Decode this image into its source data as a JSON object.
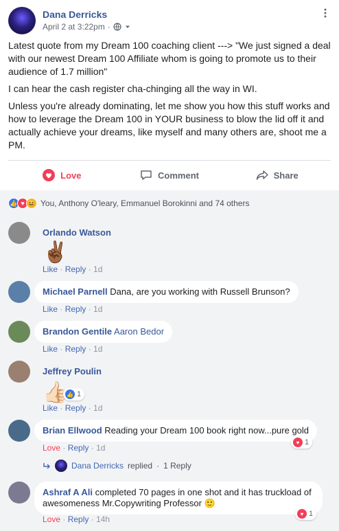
{
  "post": {
    "author": "Dana Derricks",
    "timestamp": "April 2 at 3:22pm",
    "separator": "·",
    "privacy_icon": "globe-icon",
    "paragraphs": [
      "Latest quote from my Dream 100 coaching client ---> \"We just signed a deal with our newest Dream 100 Affiliate whom is going to promote us to their audience of 1.7 million\"",
      "I can hear the cash register cha-chinging all the way in WI.",
      "Unless you're already dominating, let me show you how this stuff works and how to leverage the Dream 100 in YOUR business to blow the lid off it and actually achieve your dreams, like myself and many others are, shoot me a PM."
    ]
  },
  "actions": {
    "love": "Love",
    "comment": "Comment",
    "share": "Share"
  },
  "reactions": {
    "summary": "You, Anthony O'leary, Emmanuel Borokinni and 74 others"
  },
  "comments": [
    {
      "name": "Orlando Watson",
      "text": "",
      "sticker": "✌🏾",
      "like": "Like",
      "reply": "Reply",
      "time": "1d"
    },
    {
      "name": "Michael Parnell",
      "text": "Dana, are you working with Russell Brunson?",
      "like": "Like",
      "reply": "Reply",
      "time": "1d"
    },
    {
      "name": "Brandon Gentile",
      "text": "Aaron Bedor",
      "like": "Like",
      "reply": "Reply",
      "time": "1d"
    },
    {
      "name": "Jeffrey Poulin",
      "text": "",
      "sticker": "👍🏻",
      "reaction_count": "1",
      "like": "Like",
      "reply": "Reply",
      "time": "1d"
    },
    {
      "name": "Brian Ellwood",
      "text": "Reading your Dream 100 book right now...pure gold",
      "reaction_count": "1",
      "like": "Love",
      "reply": "Reply",
      "time": "1d",
      "replies": {
        "name": "Dana Derricks",
        "text": "replied",
        "count": "1 Reply"
      }
    },
    {
      "name": "Ashraf A Ali",
      "text": "completed 70 pages in one shot and it has truckload of awesomeness Mr.Copywriting Professor 🙂",
      "reaction_count": "1",
      "like": "Love",
      "reply": "Reply",
      "time": "14h"
    }
  ],
  "colors": {
    "link_blue": "#365899",
    "love_red": "#f33e58",
    "comment_bg": "#f2f3f5"
  }
}
